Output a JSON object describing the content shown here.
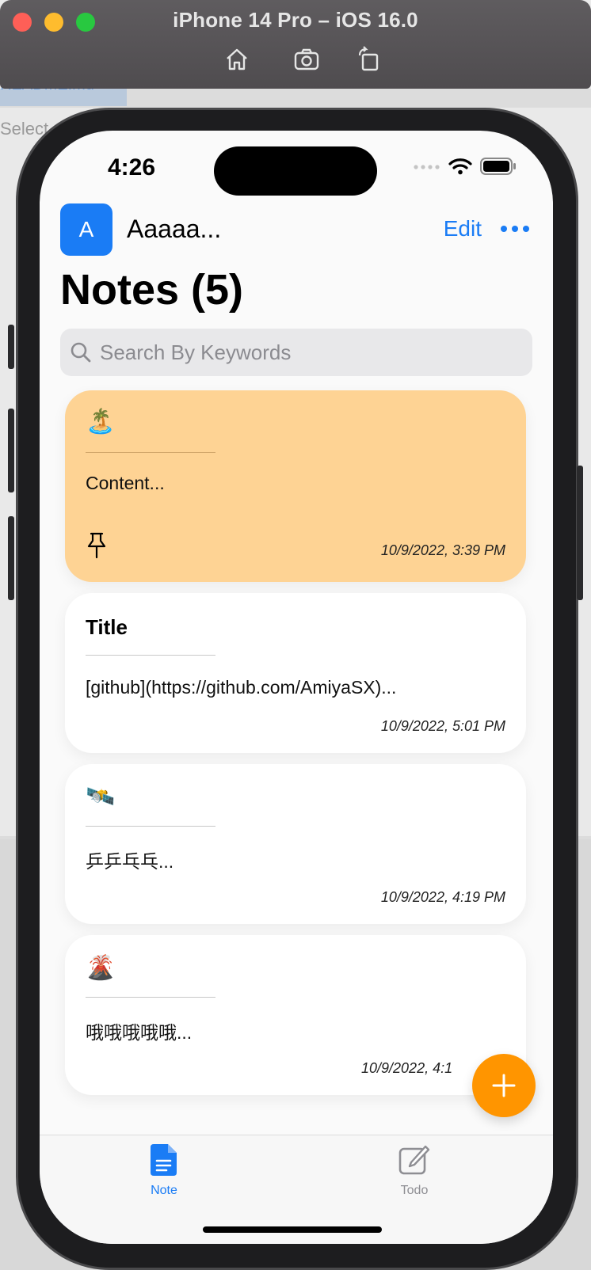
{
  "simulator": {
    "title": "iPhone 14 Pro – iOS 16.0",
    "tools": [
      "home-icon",
      "screenshot-icon",
      "rotate-icon"
    ]
  },
  "background_window": {
    "file_label": "README.md",
    "select_label": "Select"
  },
  "status_bar": {
    "time": "4:26"
  },
  "header": {
    "avatar_letter": "A",
    "user_name": "Aaaaa...",
    "edit_label": "Edit"
  },
  "page_title": "Notes (5)",
  "search": {
    "placeholder": "Search By Keywords"
  },
  "notes": [
    {
      "icon": "🏝️",
      "title": "",
      "content": "Content...",
      "date": "10/9/2022, 3:39 PM",
      "pinned": true,
      "color": "#fed394"
    },
    {
      "icon": "",
      "title": "Title",
      "content": "[github](https://github.com/AmiyaSX)...",
      "date": "10/9/2022, 5:01 PM",
      "pinned": false
    },
    {
      "icon": "🛰️",
      "title": "",
      "content": "乒乒乓乓...",
      "date": "10/9/2022, 4:19 PM",
      "pinned": false
    },
    {
      "icon": "🌋",
      "title": "",
      "content": "哦哦哦哦哦...",
      "date": "10/9/2022, 4:1",
      "pinned": false
    }
  ],
  "fab": {
    "icon": "plus-icon",
    "color": "#ff9500"
  },
  "tabs": [
    {
      "label": "Note",
      "icon": "note-icon",
      "active": true
    },
    {
      "label": "Todo",
      "icon": "compose-icon",
      "active": false
    }
  ],
  "colors": {
    "accent": "#1a7cf5",
    "fab": "#ff9500",
    "pinned_card": "#fed394"
  }
}
